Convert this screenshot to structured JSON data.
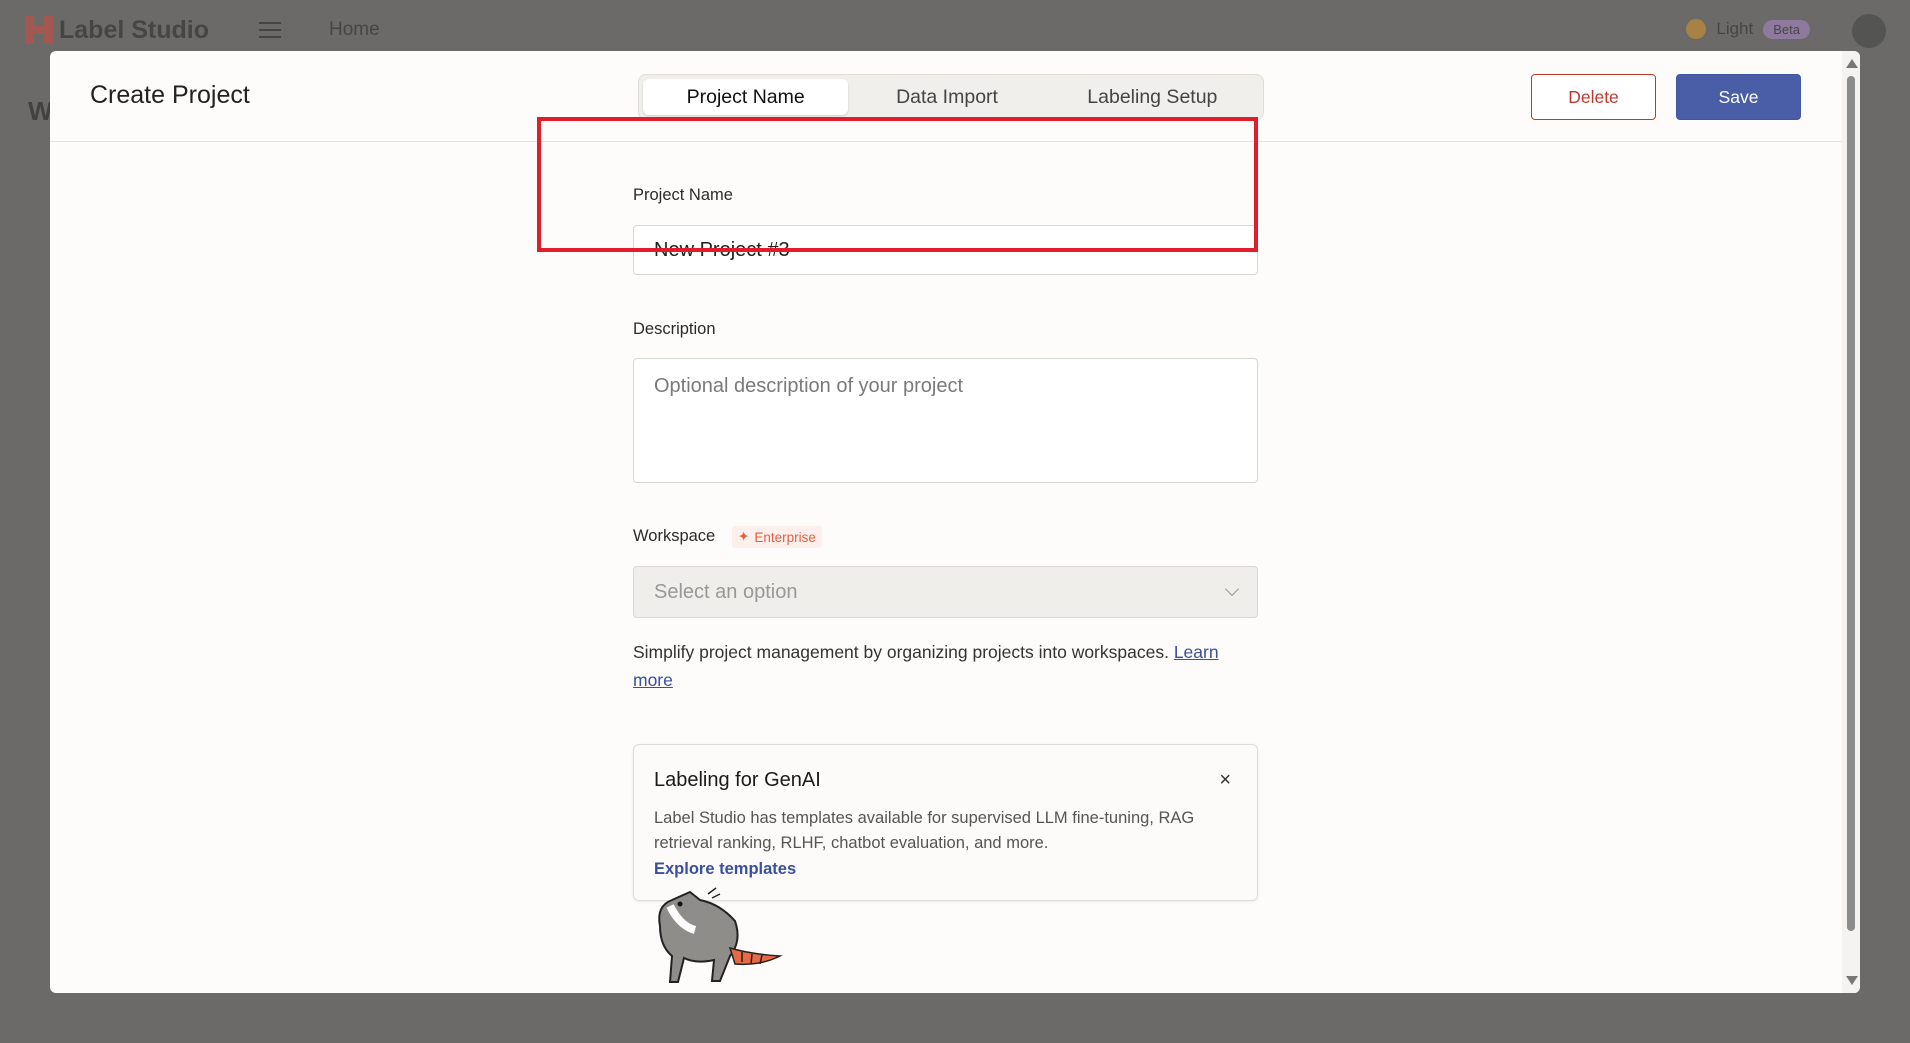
{
  "app": {
    "name": "Label Studio",
    "nav_home": "Home",
    "theme_label": "Light",
    "beta_badge": "Beta",
    "bg_heading": "W"
  },
  "modal": {
    "title": "Create Project",
    "tabs": [
      {
        "label": "Project Name",
        "active": true
      },
      {
        "label": "Data Import",
        "active": false
      },
      {
        "label": "Labeling Setup",
        "active": false
      }
    ],
    "delete_label": "Delete",
    "save_label": "Save"
  },
  "form": {
    "project_name_label": "Project Name",
    "project_name_value": "New Project #3",
    "description_label": "Description",
    "description_placeholder": "Optional description of your project",
    "workspace_label": "Workspace",
    "enterprise_badge": "Enterprise",
    "workspace_placeholder": "Select an option",
    "help_text": "Simplify project management by organizing projects into workspaces.",
    "help_link": "Learn more"
  },
  "genai": {
    "title": "Labeling for GenAI",
    "close": "×",
    "text": "Label Studio has templates available for supervised LLM fine-tuning, RAG retrieval ranking, RLHF, chatbot evaluation, and more.",
    "link": "Explore templates"
  },
  "colors": {
    "primary": "#4a5ea8",
    "danger": "#c0392b",
    "highlight": "#e01e2b",
    "enterprise": "#e0613e"
  }
}
